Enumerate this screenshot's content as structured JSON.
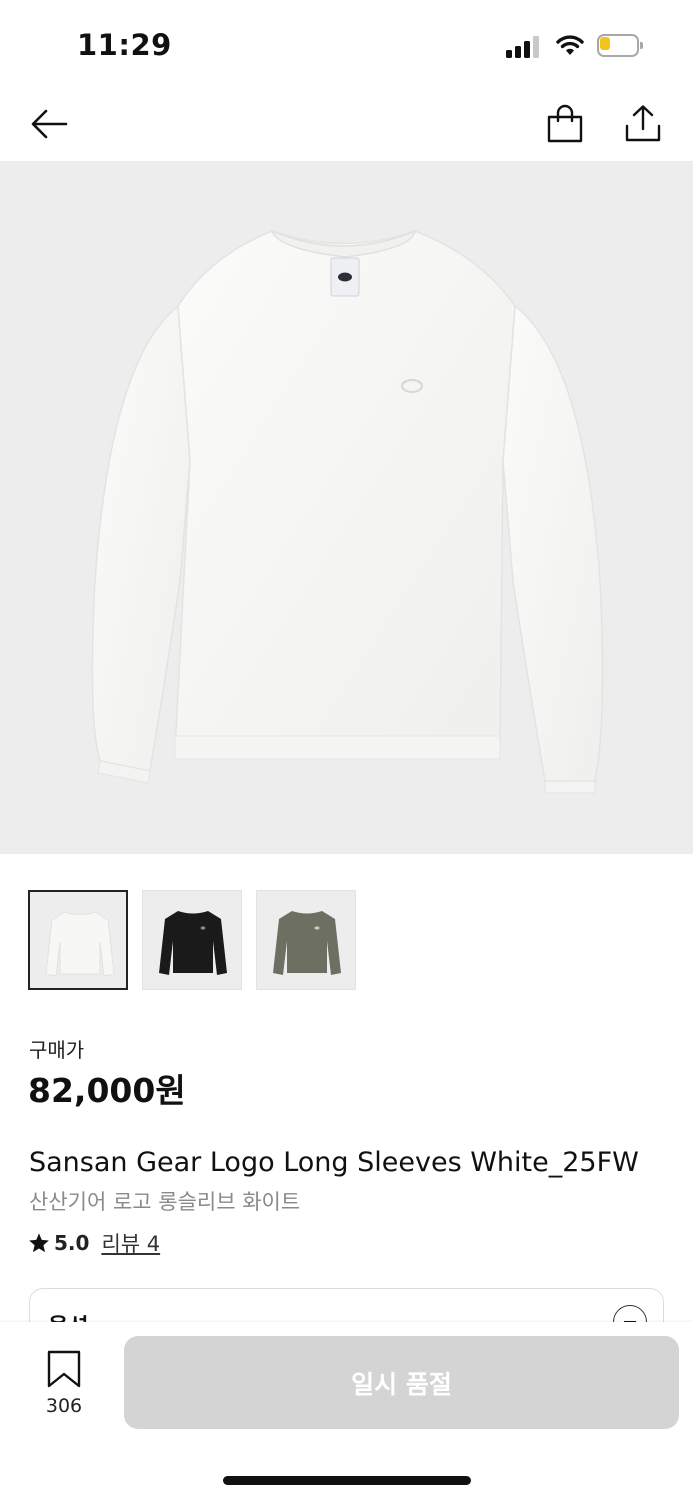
{
  "status_bar": {
    "time": "11:29",
    "icons": [
      "signal-icon",
      "wifi-icon",
      "battery-icon"
    ],
    "battery_color": "#f6c31a"
  },
  "nav": {
    "icons": [
      "back-arrow-icon",
      "shopping-bag-icon",
      "share-icon"
    ]
  },
  "product": {
    "hero_color": "white",
    "thumbnails": [
      {
        "name": "white",
        "color": "#f5f5f3",
        "selected": true
      },
      {
        "name": "black",
        "color": "#1a1a1a",
        "selected": false
      },
      {
        "name": "olive",
        "color": "#6d6f62",
        "selected": false
      }
    ],
    "price_label": "구매가",
    "price": "82,000원",
    "title_en": "Sansan Gear Logo Long Sleeves White_25FW",
    "title_ko": "산산기어 로고 롱슬리브 화이트",
    "rating": "5.0",
    "review_link": "리뷰 4"
  },
  "option": {
    "label": "옵션"
  },
  "bottom_bar": {
    "bookmark_count": "306",
    "buy_button_label": "일시 품절",
    "buy_button_color": "#d4d4d4"
  }
}
